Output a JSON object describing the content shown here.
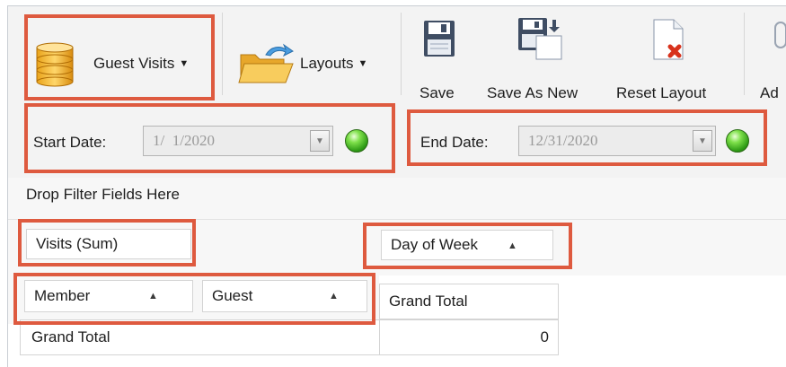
{
  "ribbon": {
    "data_source": {
      "label": "Guest Visits",
      "icon": "database-icon"
    },
    "layouts": {
      "label": "Layouts",
      "icon": "folder-icon"
    },
    "save": {
      "label": "Save",
      "icon": "floppy-disk-icon"
    },
    "save_as_new": {
      "label": "Save As New",
      "icon": "save-as-icon"
    },
    "reset_layout": {
      "label": "Reset Layout",
      "icon": "reset-document-icon"
    },
    "add": {
      "label": "Ad"
    }
  },
  "filters": {
    "start_date": {
      "label": "Start Date:",
      "value": "1/  1/2020"
    },
    "end_date": {
      "label": "End Date:",
      "value": "12/31/2020"
    }
  },
  "pivot": {
    "filter_area_placeholder": "Drop Filter Fields Here",
    "data_field": "Visits (Sum)",
    "column_field": "Day of Week",
    "row_fields": [
      "Member",
      "Guest"
    ],
    "column_grand_total": "Grand Total",
    "row_grand_total": "Grand Total",
    "grand_total_value": "0"
  },
  "colors": {
    "highlight": "#de5a3f",
    "ribbon_bg": "#f3f3f3",
    "status_ok": "#3cb520"
  }
}
